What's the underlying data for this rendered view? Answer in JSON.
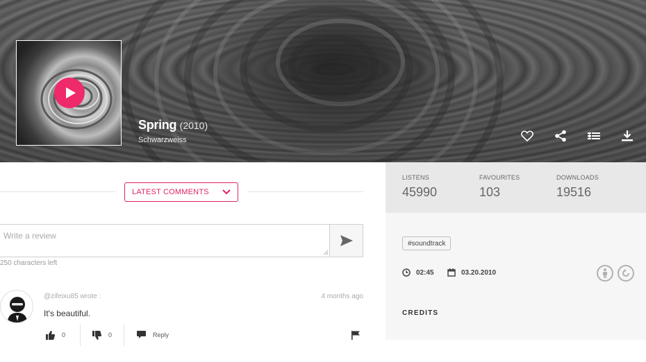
{
  "track": {
    "title": "Spring",
    "year": "(2010)",
    "artist": "Schwarzweiss"
  },
  "hero_actions": [
    "heart-icon",
    "share-icon",
    "add-to-playlist-icon",
    "download-icon"
  ],
  "comments": {
    "sort_label": "LATEST COMMENTS",
    "review_placeholder": "Write a review",
    "chars_left": "250 characters left",
    "items": [
      {
        "author": "@zifeixu85 wrote :",
        "time": "4 months ago",
        "text": "It's beautiful.",
        "likes": "0",
        "dislikes": "0",
        "reply_label": "Reply"
      }
    ]
  },
  "stats": {
    "listens_label": "LISTENS",
    "listens": "45990",
    "favourites_label": "FAVOURITES",
    "favourites": "103",
    "downloads_label": "DOWNLOADS",
    "downloads": "19516"
  },
  "details": {
    "tag": "#soundtrack",
    "duration": "02:45",
    "date": "03.20.2010",
    "credits_label": "CREDITS"
  },
  "colors": {
    "accent": "#e0245e",
    "play": "#ef2a6a",
    "stats_bg": "#e8e8e8",
    "details_bg": "#f6f6f6"
  }
}
